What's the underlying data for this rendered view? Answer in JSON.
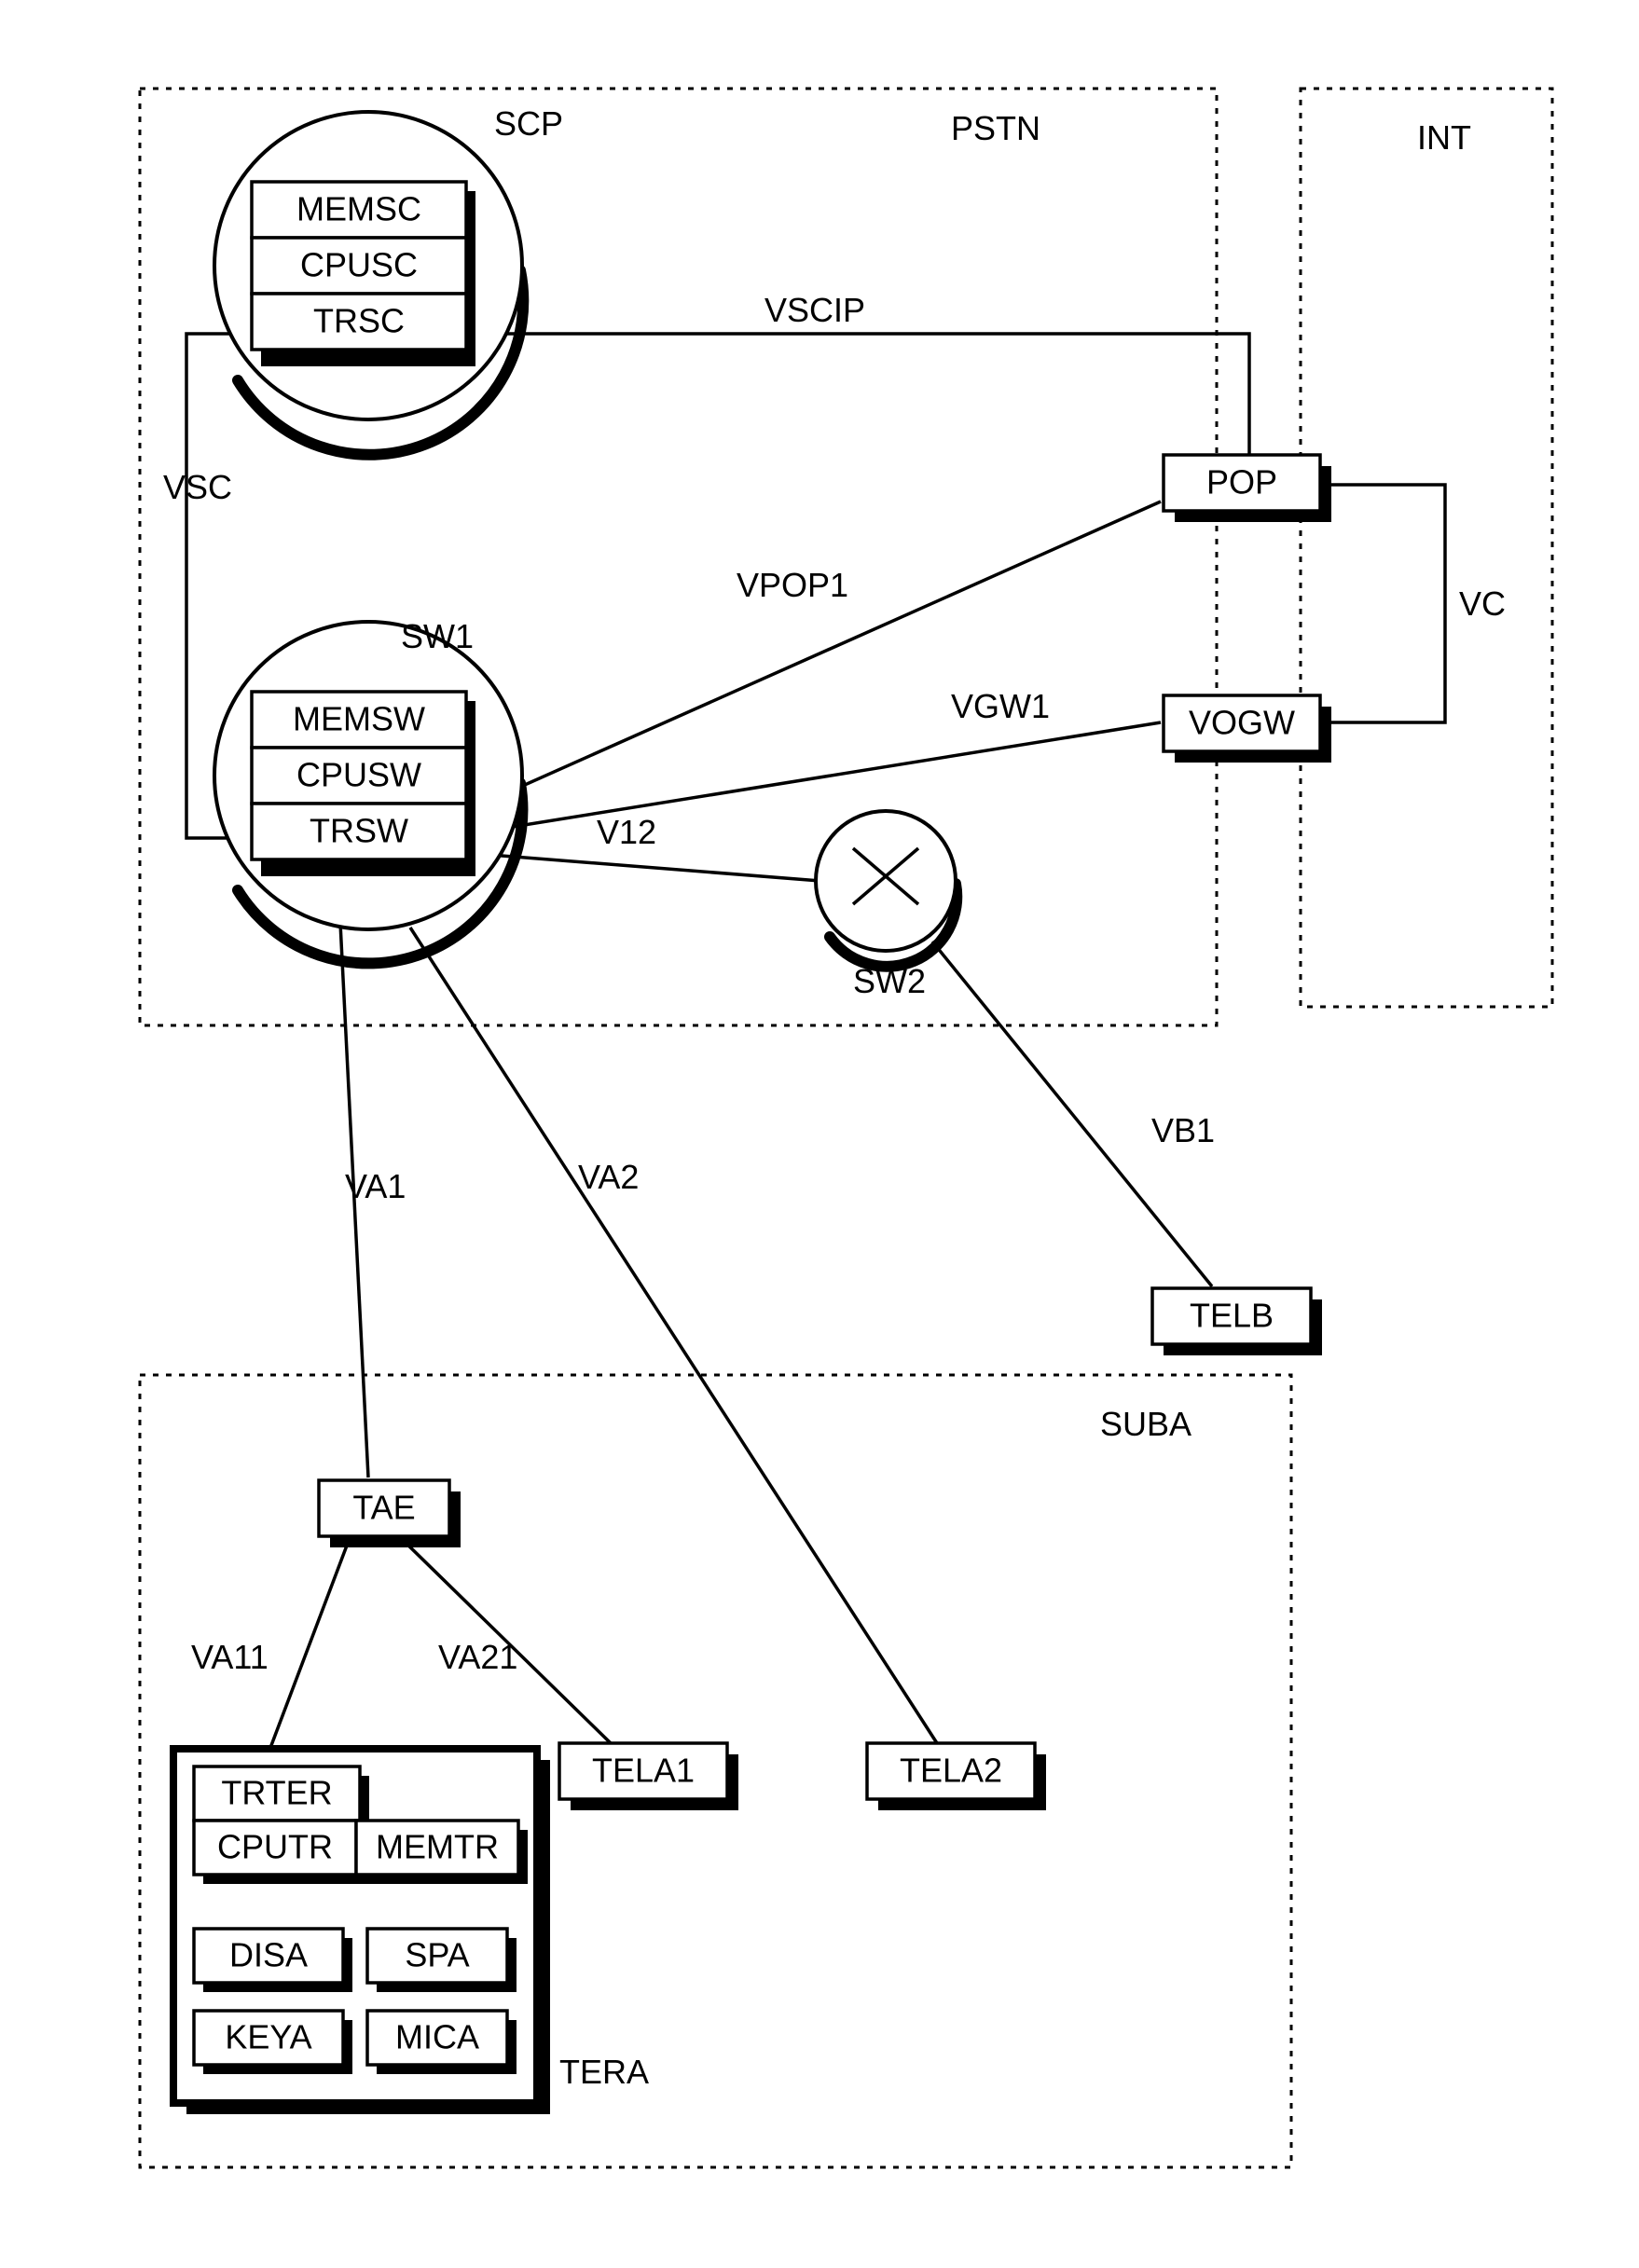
{
  "regions": {
    "pstn": "PSTN",
    "int": "INT",
    "suba": "SUBA"
  },
  "scp": {
    "name": "SCP",
    "rows": {
      "memsc": "MEMSC",
      "cpusc": "CPUSC",
      "trsc": "TRSC"
    }
  },
  "sw1": {
    "name": "SW1",
    "rows": {
      "memsw": "MEMSW",
      "cpusw": "CPUSW",
      "trsw": "TRSW"
    }
  },
  "sw2": {
    "name": "SW2"
  },
  "pop": {
    "label": "POP"
  },
  "vogw": {
    "label": "VOGW"
  },
  "tera": {
    "name": "TERA",
    "rows": {
      "trter": "TRTER",
      "cputr": "CPUTR",
      "memtr": "MEMTR",
      "disa": "DISA",
      "spa": "SPA",
      "keya": "KEYA",
      "mica": "MICA"
    }
  },
  "tae": {
    "label": "TAE"
  },
  "tela1": {
    "label": "TELA1"
  },
  "tela2": {
    "label": "TELA2"
  },
  "telb": {
    "label": "TELB"
  },
  "links": {
    "vsc": "VSC",
    "vscip": "VSCIP",
    "vc": "VC",
    "vpop1": "VPOP1",
    "vgw1": "VGW1",
    "v12": "V12",
    "va1": "VA1",
    "va2": "VA2",
    "vb1": "VB1",
    "va11": "VA11",
    "va21": "VA21"
  }
}
